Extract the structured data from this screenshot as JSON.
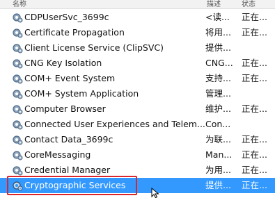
{
  "columns": {
    "name": "名称",
    "description": "描述",
    "status": "状态"
  },
  "services": [
    {
      "name": "CDPUserSvc_3699c",
      "description": "<读...",
      "status": "正在..."
    },
    {
      "name": "Certificate Propagation",
      "description": "将用...",
      "status": "正在..."
    },
    {
      "name": "Client License Service (ClipSVC)",
      "description": "提供...",
      "status": ""
    },
    {
      "name": "CNG Key Isolation",
      "description": "CNG...",
      "status": "正在..."
    },
    {
      "name": "COM+ Event System",
      "description": "支持...",
      "status": "正在..."
    },
    {
      "name": "COM+ System Application",
      "description": "管理...",
      "status": ""
    },
    {
      "name": "Computer Browser",
      "description": "维护...",
      "status": "正在..."
    },
    {
      "name": "Connected User Experiences and Telem...",
      "description": "Con...",
      "status": ""
    },
    {
      "name": "Contact Data_3699c",
      "description": "为联...",
      "status": "正在..."
    },
    {
      "name": "CoreMessaging",
      "description": "Man...",
      "status": "正在..."
    },
    {
      "name": "Credential Manager",
      "description": "为用...",
      "status": "正在..."
    },
    {
      "name": "Cryptographic Services",
      "description": "提供...",
      "status": "正在..."
    }
  ],
  "selected_index": 11,
  "icon": "gear-service-icon",
  "colors": {
    "selection": "#3399ff",
    "highlight_box": "#d9252b"
  }
}
